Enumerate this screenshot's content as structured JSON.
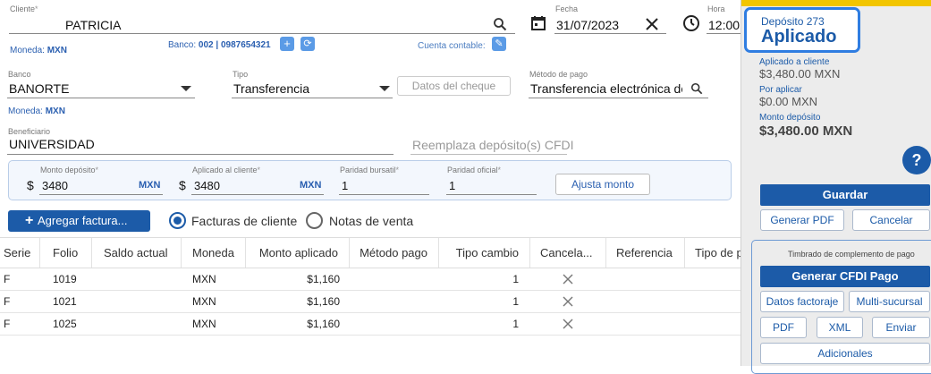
{
  "cliente": {
    "label": "Cliente",
    "value": "PATRICIA",
    "moneda_label": "Moneda:",
    "moneda_value": "MXN",
    "banco_label": "Banco:",
    "banco_value": "002 | 0987654321",
    "cuenta_contable": "Cuenta contable:"
  },
  "fecha": {
    "label": "Fecha",
    "value": "31/07/2023"
  },
  "hora": {
    "label": "Hora",
    "value": "12:00"
  },
  "banco": {
    "label": "Banco",
    "value": "BANORTE",
    "moneda_label": "Moneda:",
    "moneda_value": "MXN"
  },
  "tipo": {
    "label": "Tipo",
    "value": "Transferencia"
  },
  "datos_cheque": "Datos del cheque",
  "metodo_pago": {
    "label": "Método de pago",
    "value": "Transferencia electrónica de fondos"
  },
  "beneficiario": {
    "label": "Beneficiario",
    "value": "UNIVERSIDAD"
  },
  "reemplaza": {
    "placeholder": "Reemplaza depósito(s) CFDI"
  },
  "montos": {
    "monto_deposito_label": "Monto depósito",
    "monto_deposito_currency": "$",
    "monto_deposito_value": "3480",
    "monto_deposito_moneda": "MXN",
    "aplicado_label": "Aplicado al cliente",
    "aplicado_currency": "$",
    "aplicado_value": "3480",
    "aplicado_moneda": "MXN",
    "paridad_bursatil_label": "Paridad bursatil",
    "paridad_bursatil_value": "1",
    "paridad_oficial_label": "Paridad oficial",
    "paridad_oficial_value": "1",
    "ajusta_monto": "Ajusta monto"
  },
  "toolbar": {
    "agregar": "Agregar factura...",
    "radio_facturas": "Facturas de cliente",
    "radio_notas": "Notas de venta"
  },
  "table": {
    "headers": [
      "Serie",
      "Folio",
      "Saldo actual",
      "Moneda",
      "Monto aplicado",
      "Método pago",
      "Tipo cambio",
      "Cancela...",
      "Referencia",
      "Tipo de p"
    ],
    "rows": [
      {
        "serie": "F",
        "folio": "1019",
        "moneda": "MXN",
        "monto": "$1,160",
        "tipo_cambio": "1"
      },
      {
        "serie": "F",
        "folio": "1021",
        "moneda": "MXN",
        "monto": "$1,160",
        "tipo_cambio": "1"
      },
      {
        "serie": "F",
        "folio": "1025",
        "moneda": "MXN",
        "monto": "$1,160",
        "tipo_cambio": "1"
      }
    ]
  },
  "panel": {
    "deposito": "Depósito 273",
    "estado": "Aplicado",
    "aplicado_cliente_label": "Aplicado a cliente",
    "aplicado_cliente_value": "$3,480.00 MXN",
    "por_aplicar_label": "Por aplicar",
    "por_aplicar_value": "$0.00 MXN",
    "monto_deposito_label": "Monto depósito",
    "monto_deposito_value": "$3,480.00 MXN",
    "help": "?",
    "guardar": "Guardar",
    "generar_pdf": "Generar PDF",
    "cancelar": "Cancelar",
    "timbrado_title": "Timbrado de complemento de pago",
    "generar_cfdi": "Generar CFDI Pago",
    "datos_factoraje": "Datos factoraje",
    "multi_sucursal": "Multi-sucursal",
    "pdf": "PDF",
    "xml": "XML",
    "enviar": "Enviar",
    "adicionales": "Adicionales"
  },
  "colors": {
    "accent": "#1c5ba8",
    "highlight_border": "#2f7de1",
    "panel_bg": "#ececec",
    "top_strip": "#f2c500"
  }
}
